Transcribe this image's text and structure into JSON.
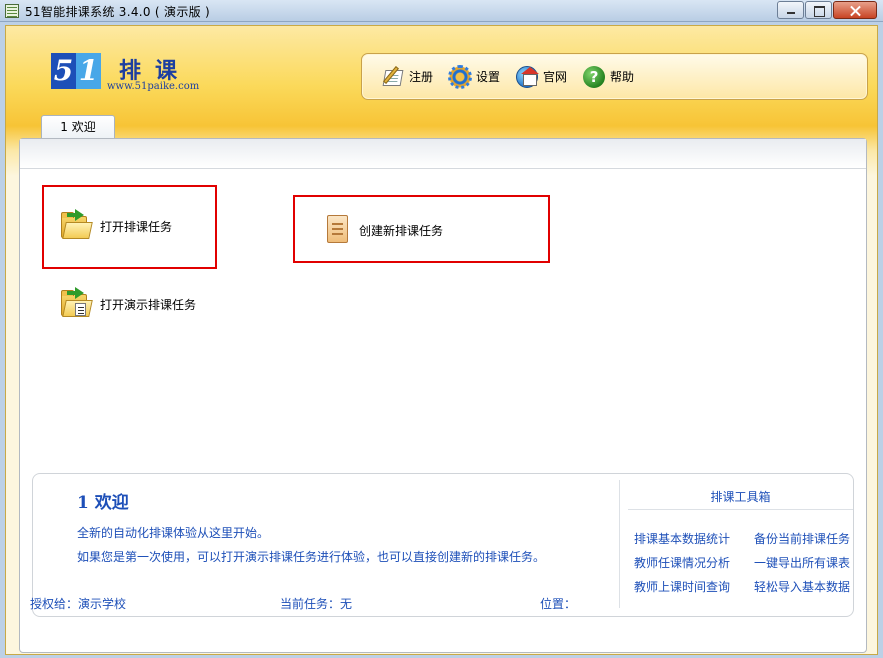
{
  "window": {
    "title": "51智能排课系统 3.4.0 ( 演示版 )",
    "controls": [
      "minimize",
      "maximize",
      "close"
    ]
  },
  "logo": {
    "digit1": "5",
    "digit2": "1",
    "name": "排课",
    "url": "www.51paike.com"
  },
  "toolbar": {
    "items": [
      {
        "label": "注册",
        "icon": "register-icon"
      },
      {
        "label": "设置",
        "icon": "gear-icon"
      },
      {
        "label": "官网",
        "icon": "website-icon"
      },
      {
        "label": "帮助",
        "icon": "help-icon"
      }
    ]
  },
  "tabs": [
    {
      "label": "1 欢迎",
      "active": true
    }
  ],
  "actions": {
    "open_task": "打开排课任务",
    "new_task": "创建新排课任务",
    "open_demo": "打开演示排课任务"
  },
  "info": {
    "heading": "1  欢迎",
    "line1": "全新的自动化排课体验从这里开始。",
    "line2": "如果您是第一次使用，可以打开演示排课任务进行体验，也可以直接创建新的排课任务。"
  },
  "toolbox": {
    "title": "排课工具箱",
    "links": [
      "排课基本数据统计",
      "备份当前排课任务",
      "教师任课情况分析",
      "一键导出所有课表",
      "教师上课时间查询",
      "轻松导入基本数据"
    ]
  },
  "status": {
    "licensed": "授权给：演示学校",
    "current_task": "当前任务：无",
    "location": "位置："
  },
  "colors": {
    "highlight_box": "#e10000",
    "link_blue": "#1d4fb8"
  }
}
